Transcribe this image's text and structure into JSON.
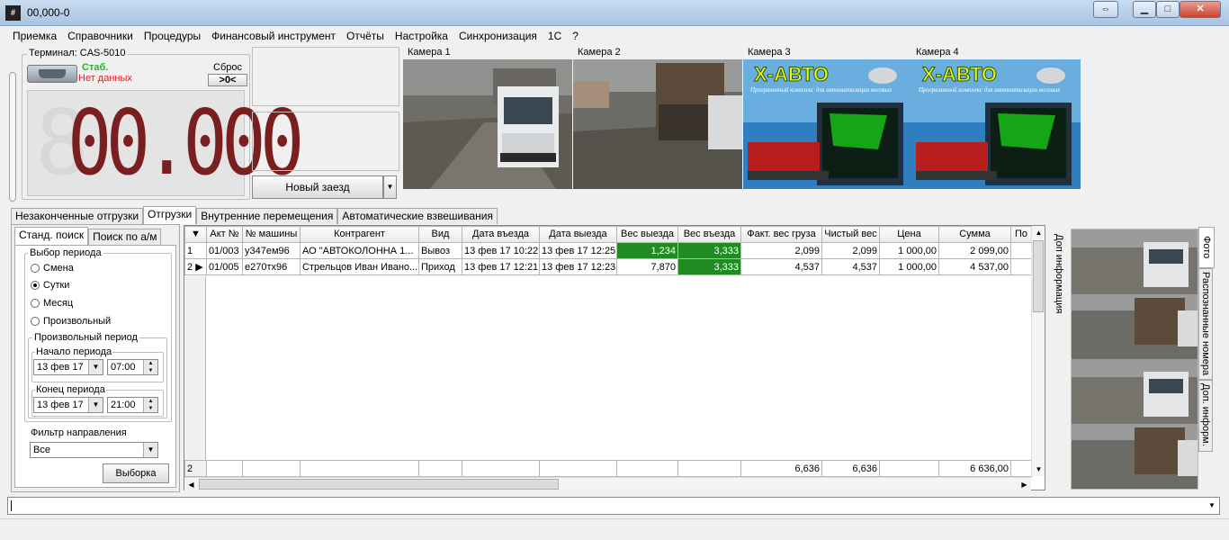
{
  "window": {
    "title": "00,000-0",
    "app_icon_label": "#"
  },
  "menu": [
    "Приемка",
    "Справочники",
    "Процедуры",
    "Финансовый инструмент",
    "Отчёты",
    "Настройка",
    "Синхронизация",
    "1С",
    "?"
  ],
  "terminal": {
    "label": "Терминал: CAS-5010",
    "status_stable": "Стаб.",
    "status_nodata": "Нет данных",
    "reset_label": "Сброс",
    "zero_label": ">0<",
    "weight_display": "00.000"
  },
  "new_arrival_button": "Новый заезд",
  "cameras": [
    {
      "label": "Камера 1",
      "kind": "truck-front"
    },
    {
      "label": "Камера 2",
      "kind": "truck-rear"
    },
    {
      "label": "Камера 3",
      "kind": "logo",
      "logo": "X-АВТО",
      "tagline": "Программный комплекс для автоматизации весовых"
    },
    {
      "label": "Камера 4",
      "kind": "logo",
      "logo": "X-АВТО",
      "tagline": "Программный комплекс для автоматизации весовых"
    }
  ],
  "main_tabs": [
    "Незаконченные отгрузки",
    "Отгрузки",
    "Внутренние перемещения",
    "Автоматические взвешивания"
  ],
  "main_tabs_active": 1,
  "search_tabs": [
    "Станд. поиск",
    "Поиск по а/м"
  ],
  "period": {
    "group_label": "Выбор периода",
    "options": [
      "Смена",
      "Сутки",
      "Месяц",
      "Произвольный"
    ],
    "selected": 1,
    "custom_label": "Произвольный период",
    "start_label": "Начало периода",
    "start_date": "13 фев 17",
    "start_time": "07:00",
    "end_label": "Конец периода",
    "end_date": "13 фев 17",
    "end_time": "21:00"
  },
  "direction_filter": {
    "label": "Фильтр направления",
    "value": "Все"
  },
  "select_button": "Выборка",
  "grid": {
    "columns": [
      "Акт №",
      "№ машины",
      "Контрагент",
      "Вид",
      "Дата въезда",
      "Дата выезда",
      "Вес выезда",
      "Вес въезда",
      "Факт. вес груза",
      "Чистый вес",
      "Цена",
      "Сумма",
      "По"
    ],
    "rows": [
      {
        "n": "1",
        "cells": [
          "01/003",
          "у347ем96",
          "АО \"АВТОКОЛОННА 1...",
          "Вывоз",
          "13 фев 17 10:22",
          "13 фев 17 12:25",
          "1,234",
          "3,333",
          "2,099",
          "2,099",
          "1 000,00",
          "2 099,00",
          ""
        ]
      },
      {
        "n": "2",
        "cells": [
          "01/005",
          "е270тх96",
          "Стрельцов Иван Ивано...",
          "Приход",
          "13 фев 17 12:21",
          "13 фев 17 12:23",
          "7,870",
          "3,333",
          "4,537",
          "4,537",
          "1 000,00",
          "4 537,00",
          ""
        ]
      }
    ],
    "totals": {
      "count": "2",
      "fact": "6,636",
      "net": "6,636",
      "sum": "6 636,00"
    }
  },
  "side_tabs": [
    "Фото",
    "Распознанные номера",
    "Доп. информ."
  ],
  "side_caption": "Доп информация",
  "colors": {
    "highlight_green": "#218b21",
    "stable_green": "#1bbf1b",
    "nodata_red": "#e02020",
    "led_segment": "#7a1f1f"
  }
}
